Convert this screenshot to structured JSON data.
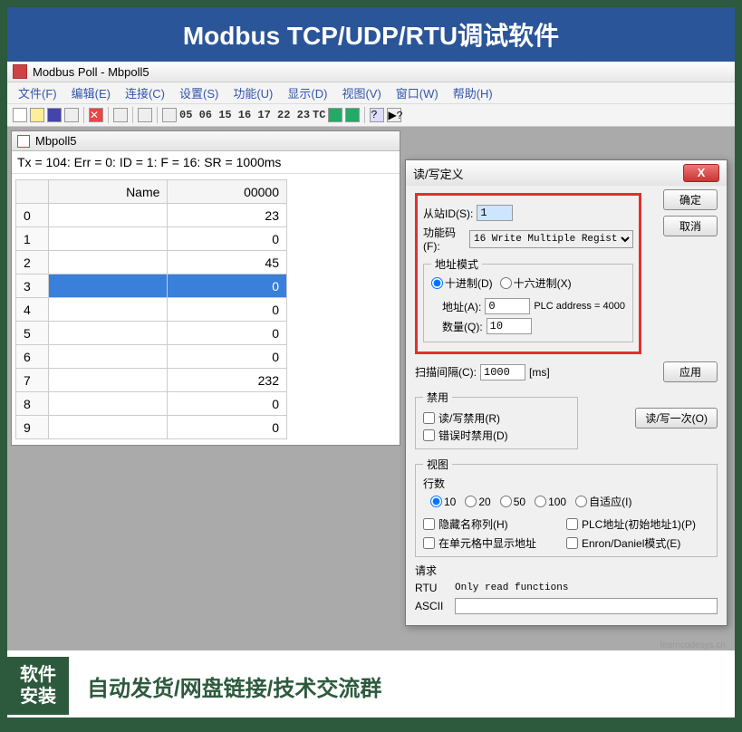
{
  "banner_top": "Modbus TCP/UDP/RTU调试软件",
  "app_title": "Modbus Poll - Mbpoll5",
  "menu": [
    "文件(F)",
    "编辑(E)",
    "连接(C)",
    "设置(S)",
    "功能(U)",
    "显示(D)",
    "视图(V)",
    "窗口(W)",
    "帮助(H)"
  ],
  "toolbar_codes": "05 06 15 16 17 22 23",
  "toolbar_tc": "TC",
  "child_title": "Mbpoll5",
  "status_line": "Tx = 104: Err = 0: ID = 1: F = 16: SR = 1000ms",
  "table": {
    "col_name": "Name",
    "col_val": "00000",
    "rows": [
      {
        "idx": "0",
        "name": "",
        "val": "23"
      },
      {
        "idx": "1",
        "name": "",
        "val": "0"
      },
      {
        "idx": "2",
        "name": "",
        "val": "45"
      },
      {
        "idx": "3",
        "name": "",
        "val": "0",
        "selected": true
      },
      {
        "idx": "4",
        "name": "",
        "val": "0"
      },
      {
        "idx": "5",
        "name": "",
        "val": "0"
      },
      {
        "idx": "6",
        "name": "",
        "val": "0"
      },
      {
        "idx": "7",
        "name": "",
        "val": "232"
      },
      {
        "idx": "8",
        "name": "",
        "val": "0"
      },
      {
        "idx": "9",
        "name": "",
        "val": "0"
      }
    ]
  },
  "dialog": {
    "title": "读/写定义",
    "close": "X",
    "slave_id_label": "从站ID(S):",
    "slave_id_value": "1",
    "func_label": "功能码(F):",
    "func_value": "16 Write Multiple Regist",
    "addr_mode_legend": "地址模式",
    "radio_dec": "十进制(D)",
    "radio_hex": "十六进制(X)",
    "addr_label": "地址(A):",
    "addr_value": "0",
    "plc_addr": "PLC address = 4000",
    "qty_label": "数量(Q):",
    "qty_value": "10",
    "scan_label": "扫描间隔(C):",
    "scan_value": "1000",
    "scan_unit": "[ms]",
    "disable_legend": "禁用",
    "cb_disable_rw": "读/写禁用(R)",
    "cb_disable_err": "错误时禁用(D)",
    "view_legend": "视图",
    "rows_label": "行数",
    "radio_10": "10",
    "radio_20": "20",
    "radio_50": "50",
    "radio_100": "100",
    "radio_auto": "自适应(I)",
    "cb_hide_name": "隐藏名称列(H)",
    "cb_plc_addr": "PLC地址(初始地址1)(P)",
    "cb_show_addr": "在单元格中显示地址",
    "cb_enron": "Enron/Daniel模式(E)",
    "req_label": "请求",
    "rtu_label": "RTU",
    "rtu_text": "Only read functions",
    "ascii_label": "ASCII",
    "btn_ok": "确定",
    "btn_cancel": "取消",
    "btn_apply": "应用",
    "btn_once": "读/写一次(O)"
  },
  "banner_bottom_left_1": "软件",
  "banner_bottom_left_2": "安装",
  "banner_bottom_right": "自动发货/网盘链接/技术交流群",
  "watermark": "learncodesys.cn"
}
